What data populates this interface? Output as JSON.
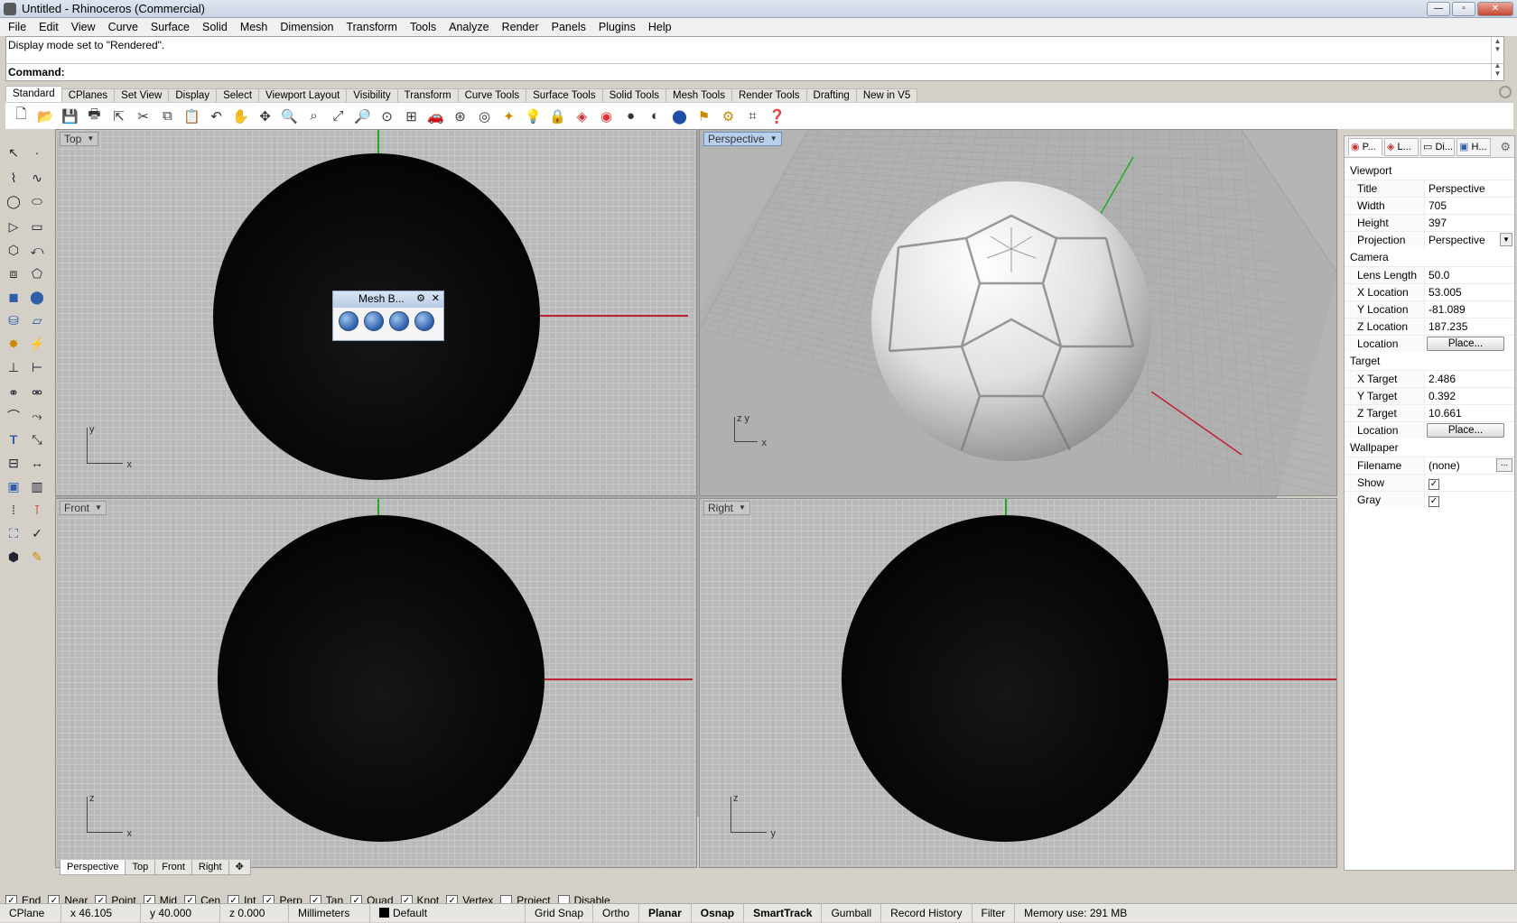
{
  "window": {
    "title": "Untitled - Rhinoceros (Commercial)"
  },
  "menu": [
    "File",
    "Edit",
    "View",
    "Curve",
    "Surface",
    "Solid",
    "Mesh",
    "Dimension",
    "Transform",
    "Tools",
    "Analyze",
    "Render",
    "Panels",
    "Plugins",
    "Help"
  ],
  "command": {
    "history": "Display mode set to \"Rendered\".",
    "prompt": "Command:"
  },
  "toolbar_tabs": [
    "Standard",
    "CPlanes",
    "Set View",
    "Display",
    "Select",
    "Viewport Layout",
    "Visibility",
    "Transform",
    "Curve Tools",
    "Surface Tools",
    "Solid Tools",
    "Mesh Tools",
    "Render Tools",
    "Drafting",
    "New in V5"
  ],
  "viewports": {
    "top": {
      "label": "Top"
    },
    "perspective": {
      "label": "Perspective"
    },
    "front": {
      "label": "Front"
    },
    "right": {
      "label": "Right"
    }
  },
  "mesh_panel": {
    "title": "Mesh B..."
  },
  "viewport_tabs": [
    "Perspective",
    "Top",
    "Front",
    "Right"
  ],
  "properties": {
    "tabs": [
      "P...",
      "L...",
      "Di...",
      "H..."
    ],
    "sections": {
      "viewport": "Viewport",
      "camera": "Camera",
      "target": "Target",
      "wallpaper": "Wallpaper"
    },
    "viewport": {
      "title_k": "Title",
      "title_v": "Perspective",
      "width_k": "Width",
      "width_v": "705",
      "height_k": "Height",
      "height_v": "397",
      "proj_k": "Projection",
      "proj_v": "Perspective"
    },
    "camera": {
      "lens_k": "Lens Length",
      "lens_v": "50.0",
      "xloc_k": "X Location",
      "xloc_v": "53.005",
      "yloc_k": "Y Location",
      "yloc_v": "-81.089",
      "zloc_k": "Z Location",
      "zloc_v": "187.235",
      "loc_k": "Location",
      "loc_btn": "Place..."
    },
    "target": {
      "xt_k": "X Target",
      "xt_v": "2.486",
      "yt_k": "Y Target",
      "yt_v": "0.392",
      "zt_k": "Z Target",
      "zt_v": "10.661",
      "loc_k": "Location",
      "loc_btn": "Place..."
    },
    "wallpaper": {
      "file_k": "Filename",
      "file_v": "(none)",
      "show_k": "Show",
      "gray_k": "Gray"
    }
  },
  "osnaps": [
    {
      "label": "End",
      "checked": true
    },
    {
      "label": "Near",
      "checked": true
    },
    {
      "label": "Point",
      "checked": true
    },
    {
      "label": "Mid",
      "checked": true
    },
    {
      "label": "Cen",
      "checked": true
    },
    {
      "label": "Int",
      "checked": true
    },
    {
      "label": "Perp",
      "checked": true
    },
    {
      "label": "Tan",
      "checked": true
    },
    {
      "label": "Quad",
      "checked": true
    },
    {
      "label": "Knot",
      "checked": true
    },
    {
      "label": "Vertex",
      "checked": true
    },
    {
      "label": "Project",
      "checked": false
    },
    {
      "label": "Disable",
      "checked": false
    }
  ],
  "status": {
    "cplane": "CPlane",
    "x": "x 46.105",
    "y": "y 40.000",
    "z": "z 0.000",
    "units": "Millimeters",
    "layer": "Default",
    "grid_snap": "Grid Snap",
    "ortho": "Ortho",
    "planar": "Planar",
    "osnap": "Osnap",
    "smarttrack": "SmartTrack",
    "gumball": "Gumball",
    "record_history": "Record History",
    "filter": "Filter",
    "memory": "Memory use: 291 MB"
  },
  "colors": {
    "x_axis": "#b22233",
    "y_axis": "#22aa22",
    "active_label": "#b8d0ec"
  }
}
